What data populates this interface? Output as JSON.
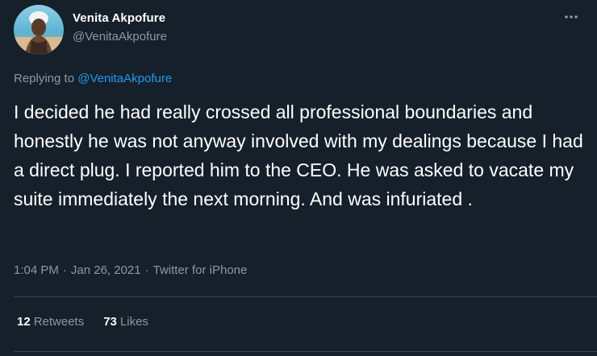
{
  "author": {
    "display_name": "Venita Akpofure",
    "handle": "@VenitaAkpofure"
  },
  "reply": {
    "prefix": "Replying to",
    "mention": "@VenitaAkpofure"
  },
  "tweet": {
    "text": "I decided he had really crossed all professional boundaries and honestly he was not anyway involved with my dealings because I had a direct plug. I reported him to the CEO. He was asked to vacate my suite immediately the next morning. And was infuriated ."
  },
  "meta": {
    "time": "1:04 PM",
    "separator": "·",
    "date": "Jan 26, 2021",
    "source": "Twitter for iPhone"
  },
  "stats": {
    "retweets_count": "12",
    "retweets_label": "Retweets",
    "likes_count": "73",
    "likes_label": "Likes"
  },
  "icons": {
    "more": "more-dots-icon"
  },
  "colors": {
    "background": "#15202b",
    "secondary_text": "#8b98a5",
    "link": "#1d9bf0",
    "divider": "#38444d"
  }
}
